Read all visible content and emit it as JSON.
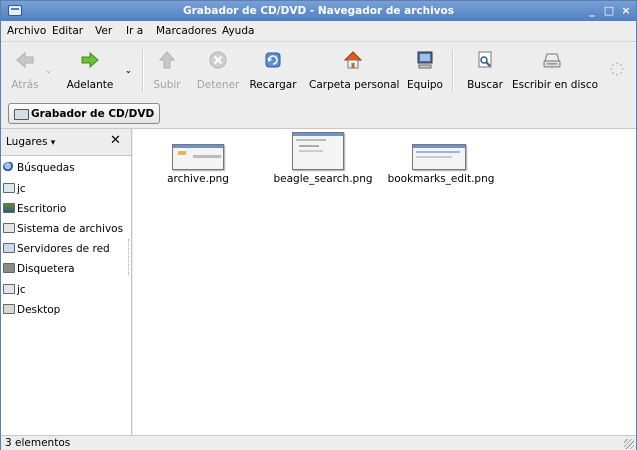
{
  "window": {
    "title": "Grabador de CD/DVD - Navegador de archivos"
  },
  "menubar": [
    "Archivo",
    "Editar",
    "Ver",
    "Ir a",
    "Marcadores",
    "Ayuda"
  ],
  "toolbar": {
    "back": "Atrás",
    "forward": "Adelante",
    "up": "Subir",
    "stop": "Detener",
    "reload": "Recargar",
    "home": "Carpeta personal",
    "computer": "Equipo",
    "search": "Buscar",
    "burn": "Escribir en disco"
  },
  "location": {
    "button": "Grabador de CD/DVD"
  },
  "sidebar": {
    "selector": "Lugares",
    "close_icon": "close-icon",
    "items": [
      {
        "label": "Búsquedas",
        "icon": "search-icon"
      },
      {
        "label": "jc",
        "icon": "home-folder-icon"
      },
      {
        "label": "Escritorio",
        "icon": "desktop-icon"
      },
      {
        "label": "Sistema de archivos",
        "icon": "drive-icon"
      },
      {
        "label": "Servidores de red",
        "icon": "network-icon"
      },
      {
        "label": "Disquetera",
        "icon": "floppy-icon"
      },
      {
        "label": "jc",
        "icon": "home-folder-icon"
      },
      {
        "label": "Desktop",
        "icon": "folder-icon"
      }
    ]
  },
  "files": [
    {
      "name": "archive.png"
    },
    {
      "name": "beagle_search.png"
    },
    {
      "name": "bookmarks_edit.png"
    }
  ],
  "status": {
    "text": "3 elementos"
  },
  "colors": {
    "titlebar": "#4f7fc1",
    "accent": "#e05a1a"
  }
}
